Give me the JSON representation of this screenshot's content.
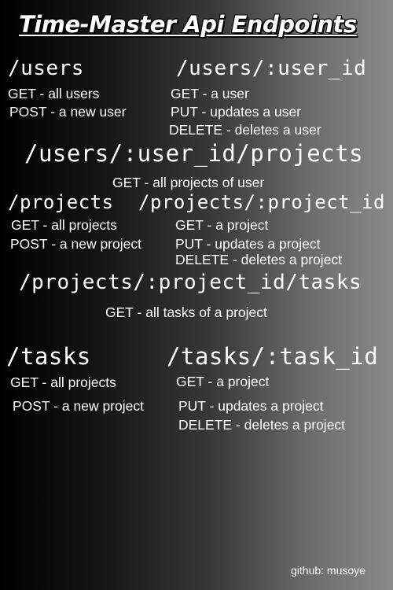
{
  "title": "Time-Master Api Endpoints",
  "users": {
    "path": "/users",
    "get": "GET - all users",
    "post": "POST - a new user"
  },
  "user_id": {
    "path": "/users/:user_id",
    "get": "GET - a user",
    "put": "PUT - updates a user",
    "delete": "DELETE - deletes a user"
  },
  "user_projects": {
    "path": "/users/:user_id/projects",
    "get": "GET - all projects of user"
  },
  "projects": {
    "path": "/projects",
    "get": "GET - all projects",
    "post": "POST - a new project"
  },
  "project_id": {
    "path": "/projects/:project_id",
    "get": "GET - a project",
    "put": "PUT - updates a project",
    "delete": "DELETE - deletes a project"
  },
  "project_tasks": {
    "path": "/projects/:project_id/tasks",
    "get": "GET - all tasks of a project"
  },
  "tasks": {
    "path": "/tasks",
    "get": "GET - all projects",
    "post": "POST - a new project"
  },
  "task_id": {
    "path": "/tasks/:task_id",
    "get": "GET - a project",
    "put": "PUT - updates a project",
    "delete": "DELETE - deletes a project"
  },
  "footer": "github: musoye"
}
